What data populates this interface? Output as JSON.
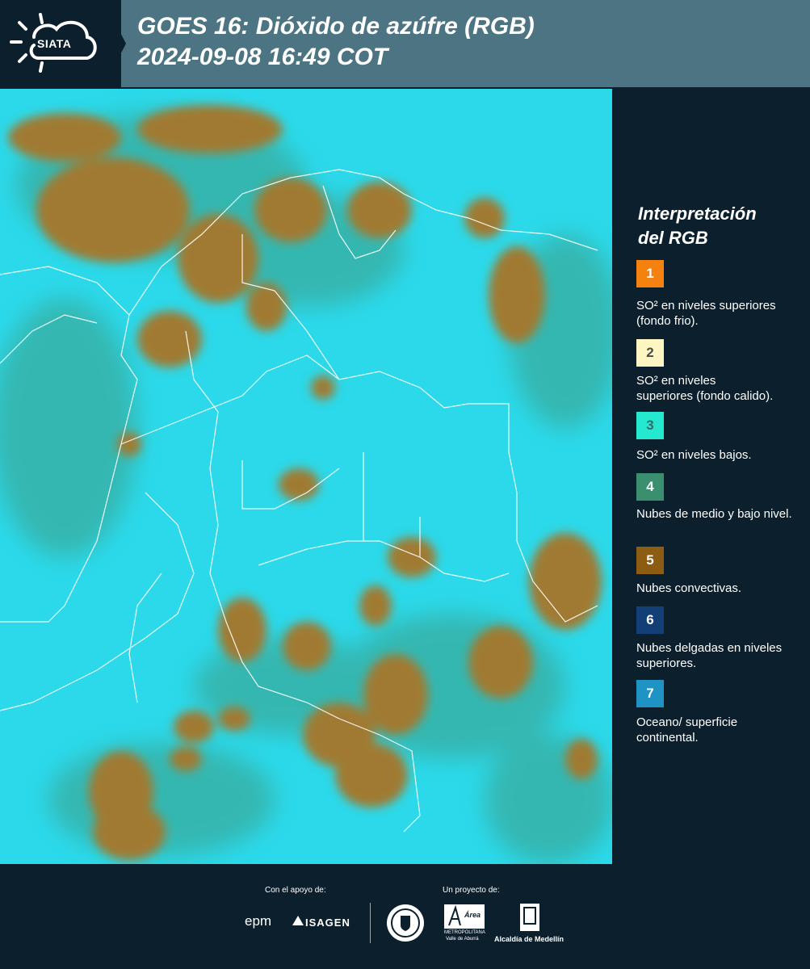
{
  "header": {
    "logo_text": "SIATA",
    "title_line1": "GOES 16: Dióxido de azúfre (RGB)",
    "title_line2": " 2024-09-08 16:49 COT"
  },
  "map": {
    "background_color": "#2bd9ea",
    "cloud_color": "#a07a30"
  },
  "legend": {
    "title_line1": "Interpretación",
    "title_line2": "del RGB",
    "items": [
      {
        "num": "1",
        "color": "#f5820f",
        "text_color": "#ffffff",
        "label": "SO² en niveles superiores (fondo frio)."
      },
      {
        "num": "2",
        "color": "#fdf6c2",
        "text_color": "#4a4a4a",
        "label": "SO² en niveles superiores (fondo calido)."
      },
      {
        "num": "3",
        "color": "#24e9cf",
        "text_color": "#3a6b6b",
        "label": "SO² en niveles bajos."
      },
      {
        "num": "4",
        "color": "#3a8f6e",
        "text_color": "#ffffff",
        "label": "Nubes de medio y bajo nivel."
      },
      {
        "num": "5",
        "color": "#8c5c12",
        "text_color": "#ffffff",
        "label": "Nubes convectivas."
      },
      {
        "num": "6",
        "color": "#123f75",
        "text_color": "#ffffff",
        "label": "Nubes delgadas en niveles superiores."
      },
      {
        "num": "7",
        "color": "#1e93c4",
        "text_color": "#ffffff",
        "label": "Oceano/ superficie continental."
      }
    ]
  },
  "footer": {
    "support_label": "Con el apoyo de:",
    "project_label": "Un proyecto de:",
    "epm": "epm",
    "isagen": "ISAGEN",
    "area_top": "Área",
    "area_sub": "METROPOLITANA",
    "area_sub2": "Valle de Aburrá",
    "alcaldia": "Alcaldía de Medellín"
  }
}
